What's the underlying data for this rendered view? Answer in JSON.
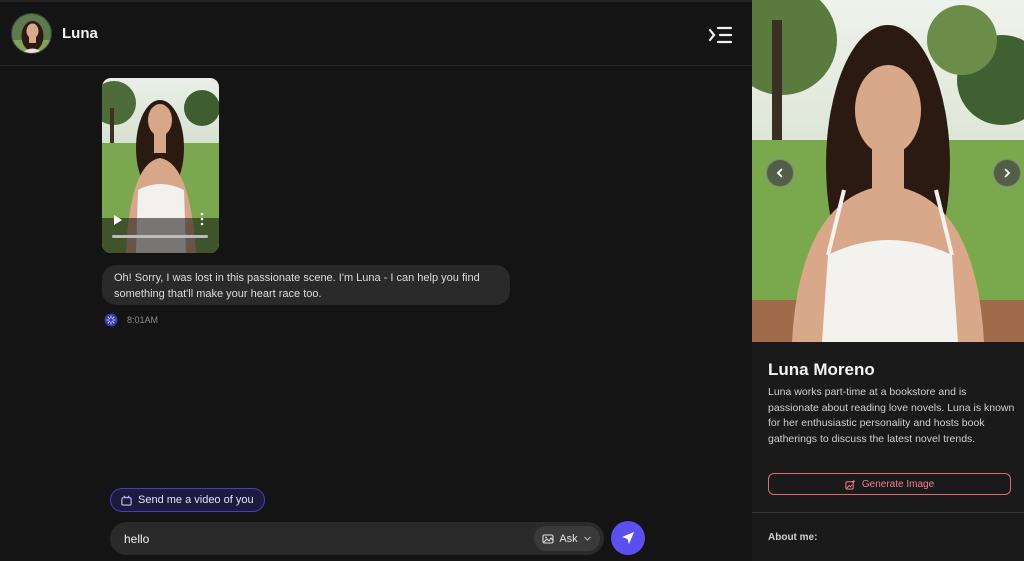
{
  "header": {
    "name": "Luna"
  },
  "message": {
    "text": "Oh! Sorry, I was lost in this passionate scene. I'm Luna - I can help you find something that'll make your heart race too.",
    "time": "8:01AM"
  },
  "suggestion": {
    "label": "Send me a video of you"
  },
  "composer": {
    "value": "hello",
    "mode_label": "Ask"
  },
  "profile": {
    "name": "Luna Moreno",
    "description": "Luna works part-time at a bookstore and is passionate about reading love novels. Luna is known for her enthusiastic personality and hosts book gatherings to discuss the latest novel trends.",
    "generate_label": "Generate Image",
    "about_label": "About me:"
  },
  "colors": {
    "accent": "#5b4ff0",
    "generate": "#e0687a",
    "bubble": "#2a2a2a"
  },
  "icons": [
    "menu-collapse-icon",
    "play-icon",
    "more-vertical-icon",
    "bot-icon",
    "video-icon",
    "image-ask-icon",
    "chevron-down-icon",
    "send-icon",
    "chevron-left-icon",
    "chevron-right-icon",
    "magic-image-icon"
  ]
}
